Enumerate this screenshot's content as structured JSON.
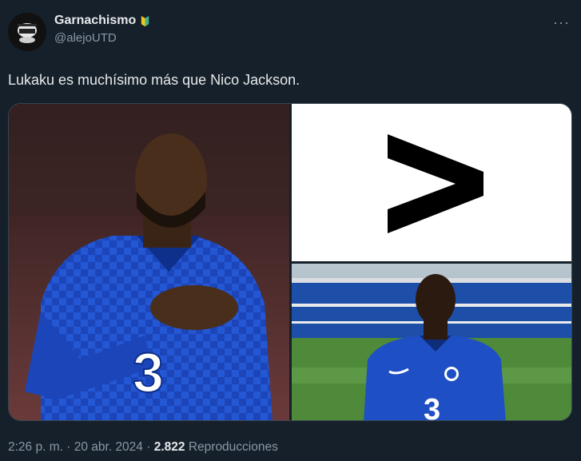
{
  "tweet": {
    "display_name": "Garnachismo",
    "handle": "@alejoUTD",
    "text": "Lukaku es muchísimo más que Nico Jackson.",
    "more_icon": "more-horizontal-icon",
    "badge_color": "#3fb58c",
    "footer": {
      "time": "2:26 p. m.",
      "separator1": "·",
      "date": "20 abr. 2024",
      "separator2": "·",
      "views_count": "2.822",
      "views_label": "Reproducciones"
    }
  },
  "colors": {
    "background": "#15202b",
    "text_primary": "#e7e9ea",
    "text_secondary": "#8b98a5",
    "chelsea_blue": "#1f4fc4"
  }
}
